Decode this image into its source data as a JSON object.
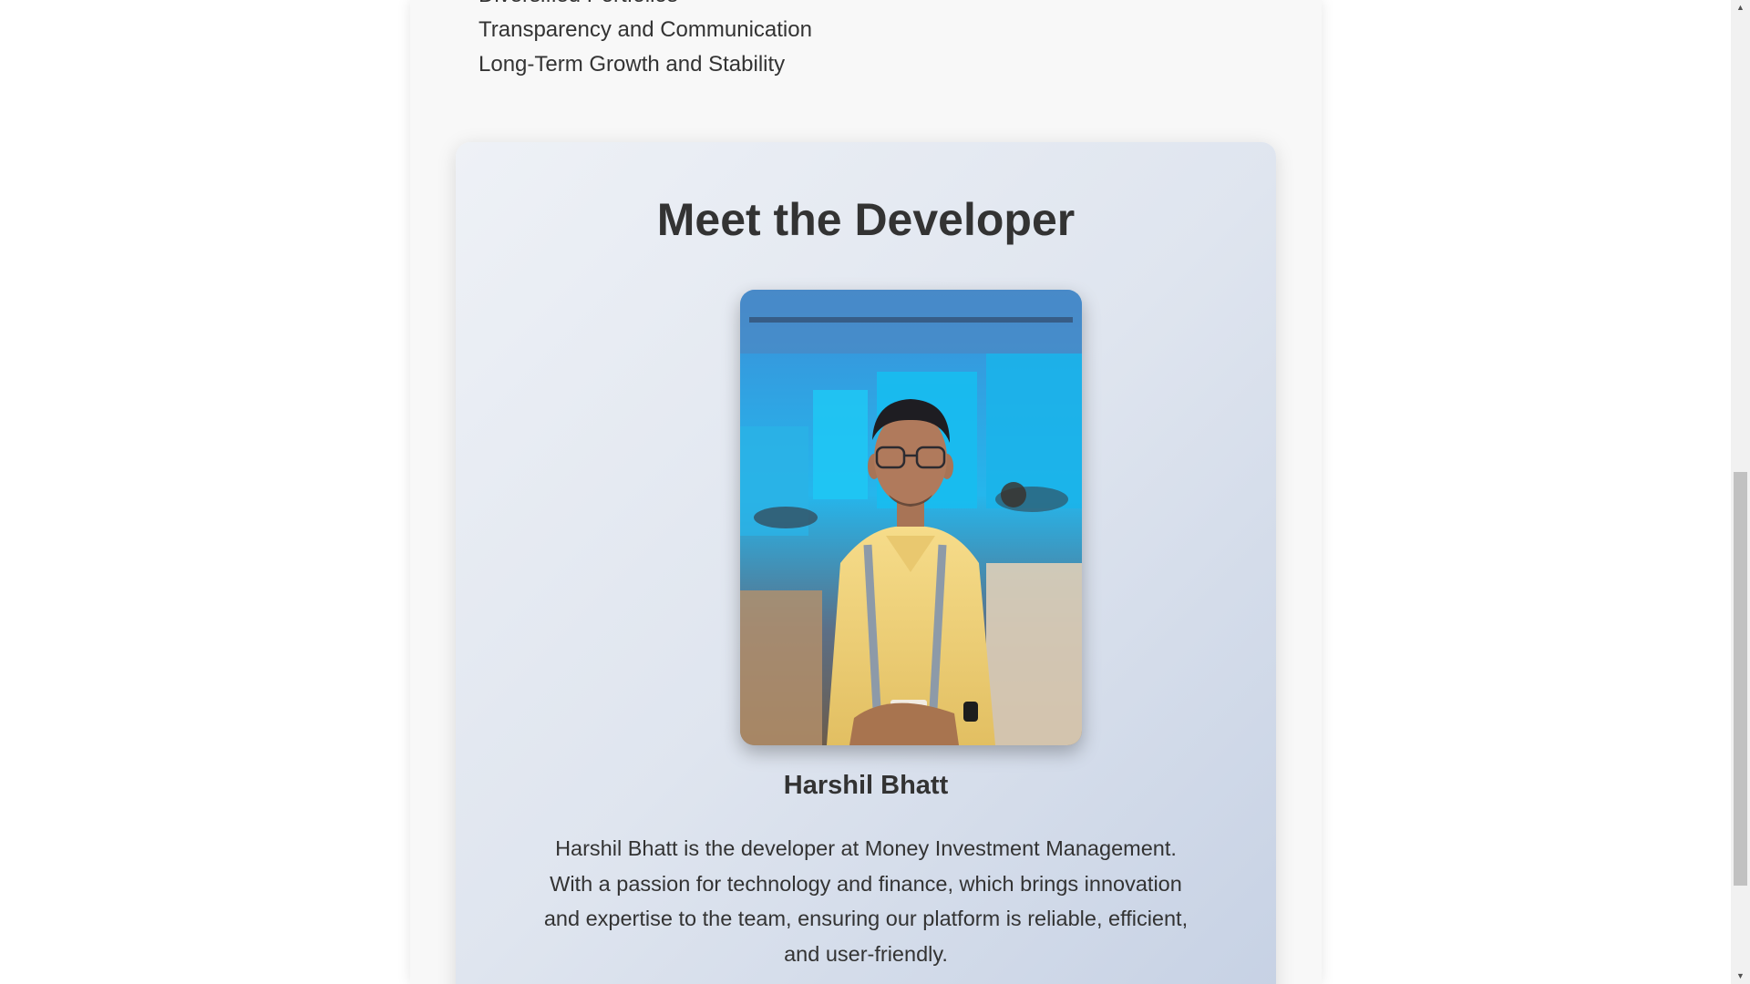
{
  "values_list": [
    "Diversified Portfolios",
    "Transparency and Communication",
    "Long-Term Growth and Stability"
  ],
  "developer": {
    "heading": "Meet the Developer",
    "name": "Harshil Bhatt",
    "bio": "Harshil Bhatt is the developer at Money Investment Management. With a passion for technology and finance, which brings innovation and expertise to the team, ensuring our platform is reliable, efficient, and user-friendly.",
    "photo_alt": "Harshil Bhatt"
  },
  "scrollbar": {
    "up_icon": "triangle-up",
    "down_icon": "triangle-down",
    "up_glyph": "▲",
    "down_glyph": "▼"
  }
}
